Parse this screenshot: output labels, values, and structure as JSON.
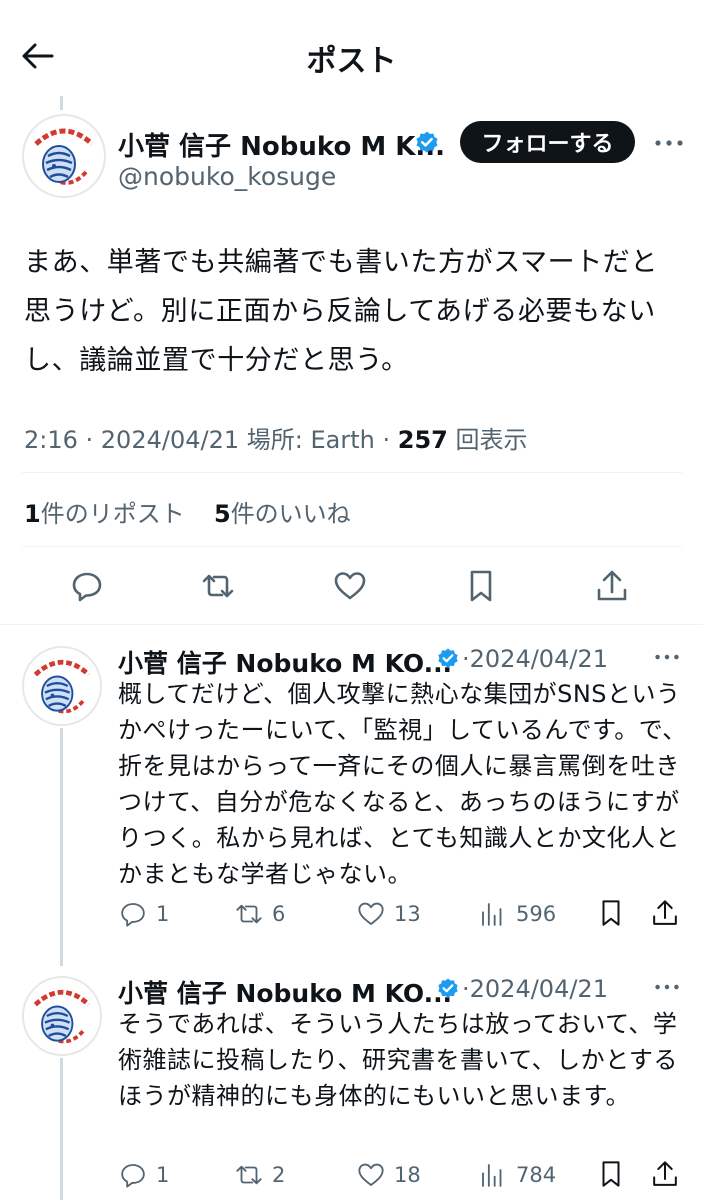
{
  "header": {
    "title": "ポスト"
  },
  "main_post": {
    "name": "小菅 信子 Nobuko M K...",
    "handle": "@nobuko_kosuge",
    "follow_label": "フォローする",
    "text": "まあ、単著でも共編著でも書いた方がスマートだと思うけど。別に正面から反論してあげる必要もないし、議論並置で十分だと思う。",
    "time_date": "2:16 · 2024/04/21",
    "location": "場所: Earth",
    "view_count": "257",
    "views_label": "回表示",
    "repost_count": "1",
    "repost_label": "件のリポスト",
    "like_count": "5",
    "like_label": "件のいいね"
  },
  "replies": [
    {
      "name": "小菅 信子 Nobuko M KO...",
      "date": "2024/04/21",
      "text": "概してだけど、個人攻撃に熱心な集団がSNSというかぺけったーにいて、「監視」しているんです。で、折を見はからって一斉にその個人に暴言罵倒を吐きつけて、自分が危なくなると、あっちのほうにすがりつく。私から見れば、とても知識人とか文化人とかまともな学者じゃない。",
      "replies": "1",
      "reposts": "6",
      "likes": "13",
      "views": "596"
    },
    {
      "name": "小菅 信子 Nobuko M KO...",
      "date": "2024/04/21",
      "text": "そうであれば、そういう人たちは放っておいて、学術雑誌に投稿したり、研究書を書いて、しかとするほうが精神的にも身体的にもいいと思います。",
      "replies": "1",
      "reposts": "2",
      "likes": "18",
      "views": "784"
    }
  ],
  "colors": {
    "verified": "#1d9bf0",
    "text": "#0f1419",
    "muted": "#536471",
    "follow_bg": "#0f1419"
  },
  "icons": [
    "back-arrow-icon",
    "verified-badge-icon",
    "more-icon",
    "reply-icon",
    "repost-icon",
    "like-icon",
    "bookmark-icon",
    "share-icon",
    "views-icon"
  ]
}
